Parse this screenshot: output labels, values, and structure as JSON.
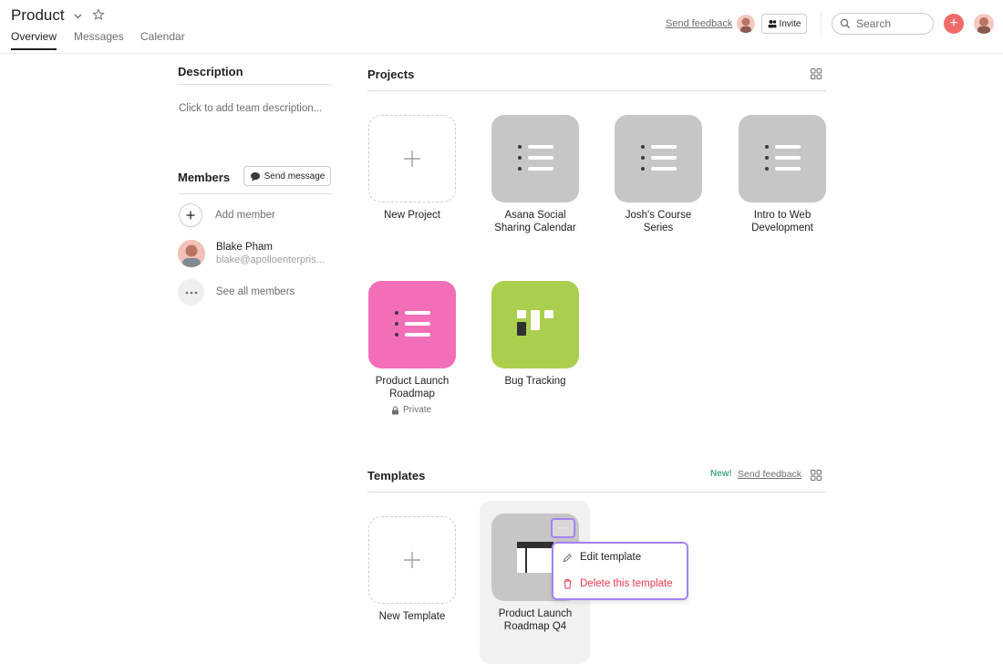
{
  "header": {
    "title": "Product",
    "tabs": [
      {
        "label": "Overview",
        "active": true
      },
      {
        "label": "Messages",
        "active": false
      },
      {
        "label": "Calendar",
        "active": false
      }
    ],
    "send_feedback": "Send feedback",
    "invite_label": "Invite",
    "search_placeholder": "Search",
    "add_label": "+"
  },
  "description": {
    "heading": "Description",
    "placeholder": "Click to add team description..."
  },
  "members": {
    "heading": "Members",
    "send_message": "Send message",
    "add_member": "Add member",
    "list": [
      {
        "name": "Blake Pham",
        "email": "blake@apolloenterpris..."
      }
    ],
    "see_all": "See all members"
  },
  "projects": {
    "heading": "Projects",
    "new_project": "New Project",
    "items": [
      {
        "name": "Asana Social Sharing Calendar",
        "line1": "Asana Social",
        "line2": "Sharing Calendar",
        "color": "#c8c6c5",
        "icon": "list-icon"
      },
      {
        "name": "Josh's Course Series",
        "line1": "Josh's Course",
        "line2": "Series",
        "color": "#c8c6c5",
        "icon": "list-icon"
      },
      {
        "name": "Intro to Web Development",
        "line1": "Intro to Web",
        "line2": "Development",
        "color": "#c8c6c5",
        "icon": "list-icon"
      },
      {
        "name": "Product Launch Roadmap",
        "line1": "Product Launch",
        "line2": "Roadmap",
        "color": "#f26fb8",
        "icon": "list-icon",
        "privacy": "Private"
      },
      {
        "name": "Bug Tracking",
        "line1": "Bug Tracking",
        "line2": "",
        "color": "#aacf4f",
        "icon": "board-icon"
      }
    ]
  },
  "templates": {
    "heading": "Templates",
    "new_badge": "New!",
    "send_feedback": "Send feedback",
    "new_template": "New Template",
    "items": [
      {
        "name": "Product Launch Roadmap Q4",
        "line1": "Product Launch",
        "line2": "Roadmap Q4",
        "icon": "timeline-icon"
      }
    ],
    "menu": {
      "more": "···",
      "edit": "Edit template",
      "delete": "Delete this template"
    }
  },
  "colors": {
    "accent": "#a582f5",
    "danger": "#f06a6a",
    "new_badge": "#4ea785"
  }
}
